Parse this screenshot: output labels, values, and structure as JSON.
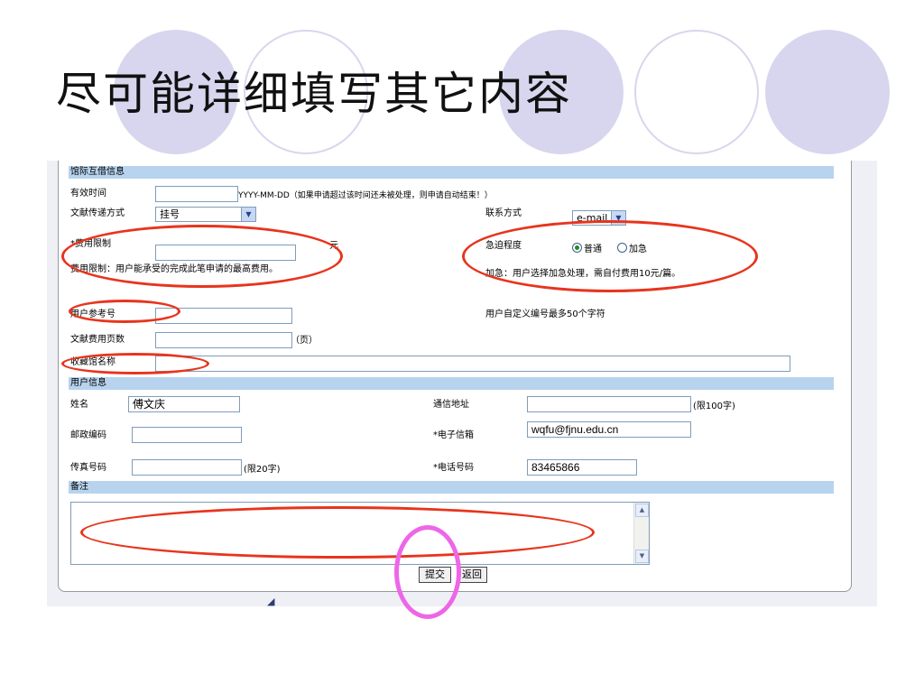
{
  "slide": {
    "title": "尽可能详细填写其它内容"
  },
  "form": {
    "section_ill": "馆际互借信息",
    "valid_time_label": "有效时间",
    "valid_time_value": "",
    "valid_time_hint": "YYYY-MM-DD（如果申请超过该时间还未被处理，则申请自动结束！）",
    "delivery_label": "文献传递方式",
    "delivery_selected": "挂号",
    "contact_label": "联系方式",
    "contact_selected": "e-mail",
    "fee_limit_label": "*费用限制",
    "fee_limit_value": "",
    "fee_unit": "元",
    "fee_note": "费用限制：用户能承受的完成此笔申请的最高费用。",
    "urgency_label": "急迫程度",
    "urgency_options": [
      "普通",
      "加急"
    ],
    "urgency_selected": "普通",
    "urgency_note": "加急：用户选择加急处理，需自付费用10元/篇。",
    "user_ref_label": "用户参考号",
    "user_ref_value": "",
    "user_ref_note": "用户自定义编号最多50个字符",
    "pages_label": "文献费用页数",
    "pages_value": "",
    "pages_unit": "（页）",
    "library_label": "收藏馆名称",
    "library_value": "",
    "section_user": "用户信息",
    "name_label": "姓名",
    "name_value": "傅文庆",
    "address_label": "通信地址",
    "address_value": "",
    "address_limit": "(限100字)",
    "postcode_label": "邮政编码",
    "postcode_value": "",
    "email_label": "*电子信箱",
    "email_value": "wqfu@fjnu.edu.cn",
    "fax_label": "传真号码",
    "fax_value": "",
    "fax_limit": "(限20字)",
    "phone_label": "*电话号码",
    "phone_value": "83465866",
    "section_remark": "备注",
    "remark_value": "",
    "submit_label": "提交",
    "back_label": "返回"
  },
  "icons": {
    "dropdown": "chevron-down-icon",
    "scroll_up": "arrow-up-icon",
    "scroll_down": "arrow-down-icon"
  },
  "colors": {
    "circle": "#d8d6ee",
    "section_bar": "#b7d3ee",
    "highlight_red": "#e8341d",
    "highlight_pink": "#ee66e8"
  }
}
